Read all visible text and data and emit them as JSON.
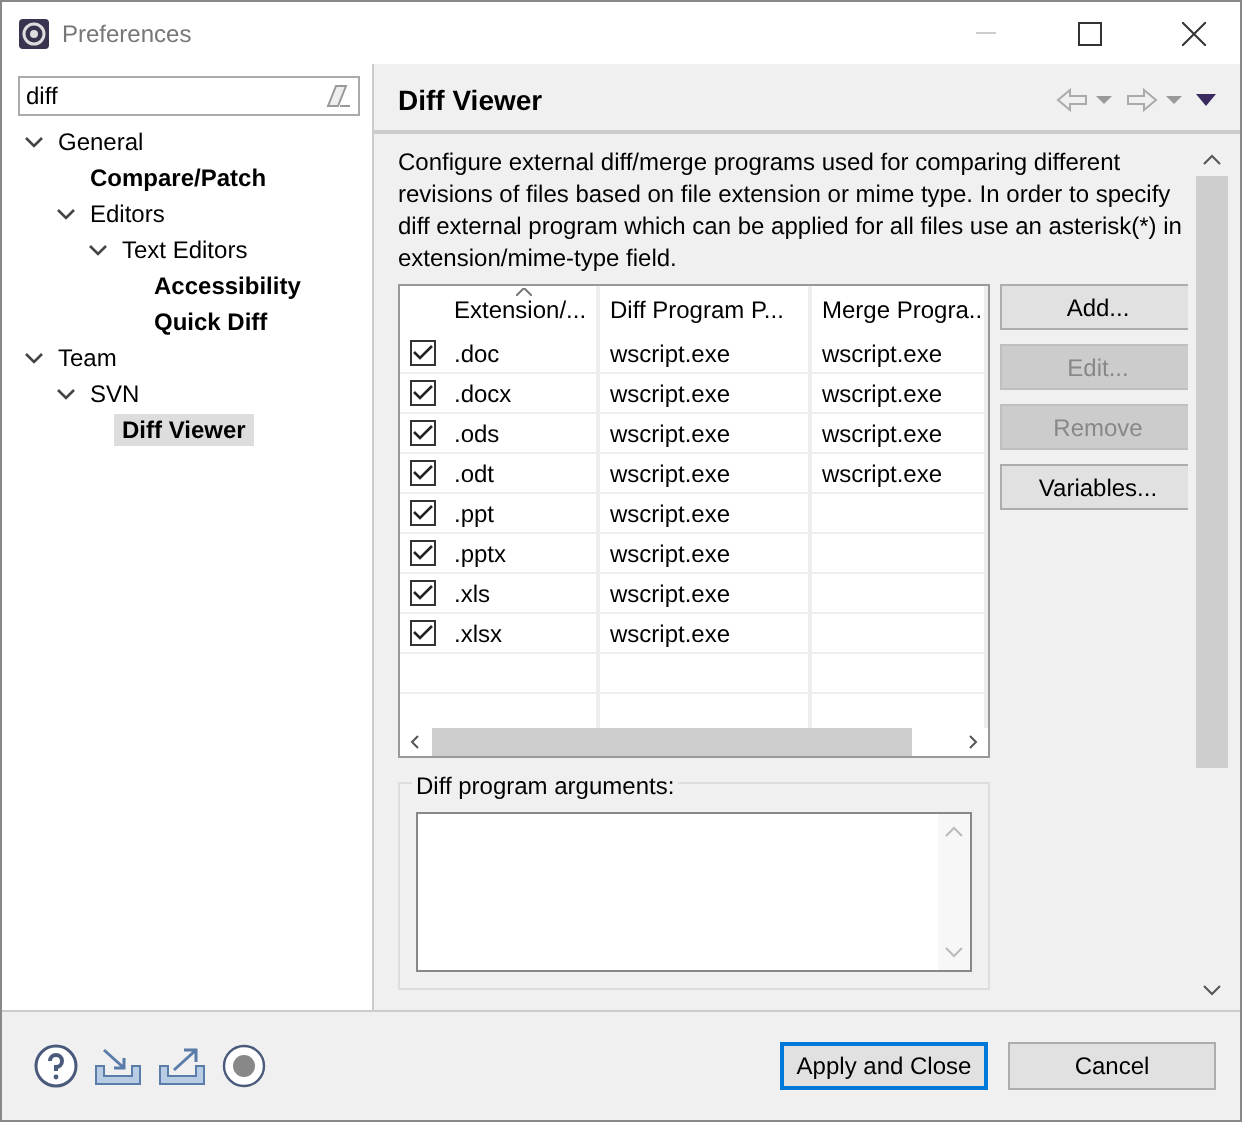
{
  "window": {
    "title": "Preferences"
  },
  "filter": {
    "value": "diff"
  },
  "tree": [
    {
      "label": "General",
      "expanded": true,
      "matched": false,
      "selected": false,
      "children": [
        {
          "label": "Compare/Patch",
          "matched": true,
          "selected": false
        },
        {
          "label": "Editors",
          "expanded": true,
          "matched": false,
          "selected": false,
          "children": [
            {
              "label": "Text Editors",
              "expanded": true,
              "matched": false,
              "selected": false,
              "children": [
                {
                  "label": "Accessibility",
                  "matched": true,
                  "selected": false
                },
                {
                  "label": "Quick Diff",
                  "matched": true,
                  "selected": false
                }
              ]
            }
          ]
        }
      ]
    },
    {
      "label": "Team",
      "expanded": true,
      "matched": false,
      "selected": false,
      "children": [
        {
          "label": "SVN",
          "expanded": true,
          "matched": false,
          "selected": false,
          "children": [
            {
              "label": "Diff Viewer",
              "matched": true,
              "selected": true
            }
          ]
        }
      ]
    }
  ],
  "page": {
    "title": "Diff Viewer",
    "description": "Configure external diff/merge programs used for comparing different revisions of files based on file extension or mime type. In order to specify diff external program which can be applied for all files use an asterisk(*) in extension/mime-type field.",
    "table": {
      "columns": [
        {
          "label": "Extension/...",
          "sorted": true
        },
        {
          "label": "Diff Program P...",
          "sorted": false
        },
        {
          "label": "Merge Progra...",
          "sorted": false
        }
      ],
      "rows": [
        {
          "checked": true,
          "extension": ".doc",
          "diff": "wscript.exe",
          "merge": "wscript.exe"
        },
        {
          "checked": true,
          "extension": ".docx",
          "diff": "wscript.exe",
          "merge": "wscript.exe"
        },
        {
          "checked": true,
          "extension": ".ods",
          "diff": "wscript.exe",
          "merge": "wscript.exe"
        },
        {
          "checked": true,
          "extension": ".odt",
          "diff": "wscript.exe",
          "merge": "wscript.exe"
        },
        {
          "checked": true,
          "extension": ".ppt",
          "diff": "wscript.exe"
        },
        {
          "checked": true,
          "extension": ".pptx",
          "diff": "wscript.exe"
        },
        {
          "checked": true,
          "extension": ".xls",
          "diff": "wscript.exe"
        },
        {
          "checked": true,
          "extension": ".xlsx",
          "diff": "wscript.exe"
        }
      ]
    },
    "side_buttons": [
      {
        "label": "Add...",
        "disabled": false
      },
      {
        "label": "Edit...",
        "disabled": true
      },
      {
        "label": "Remove",
        "disabled": true
      },
      {
        "label": "Variables...",
        "disabled": false
      }
    ],
    "arguments_group": {
      "title": "Diff program arguments:"
    }
  },
  "footer_buttons": [
    {
      "label": "Apply and Close",
      "default": true
    },
    {
      "label": "Cancel",
      "default": false
    }
  ]
}
